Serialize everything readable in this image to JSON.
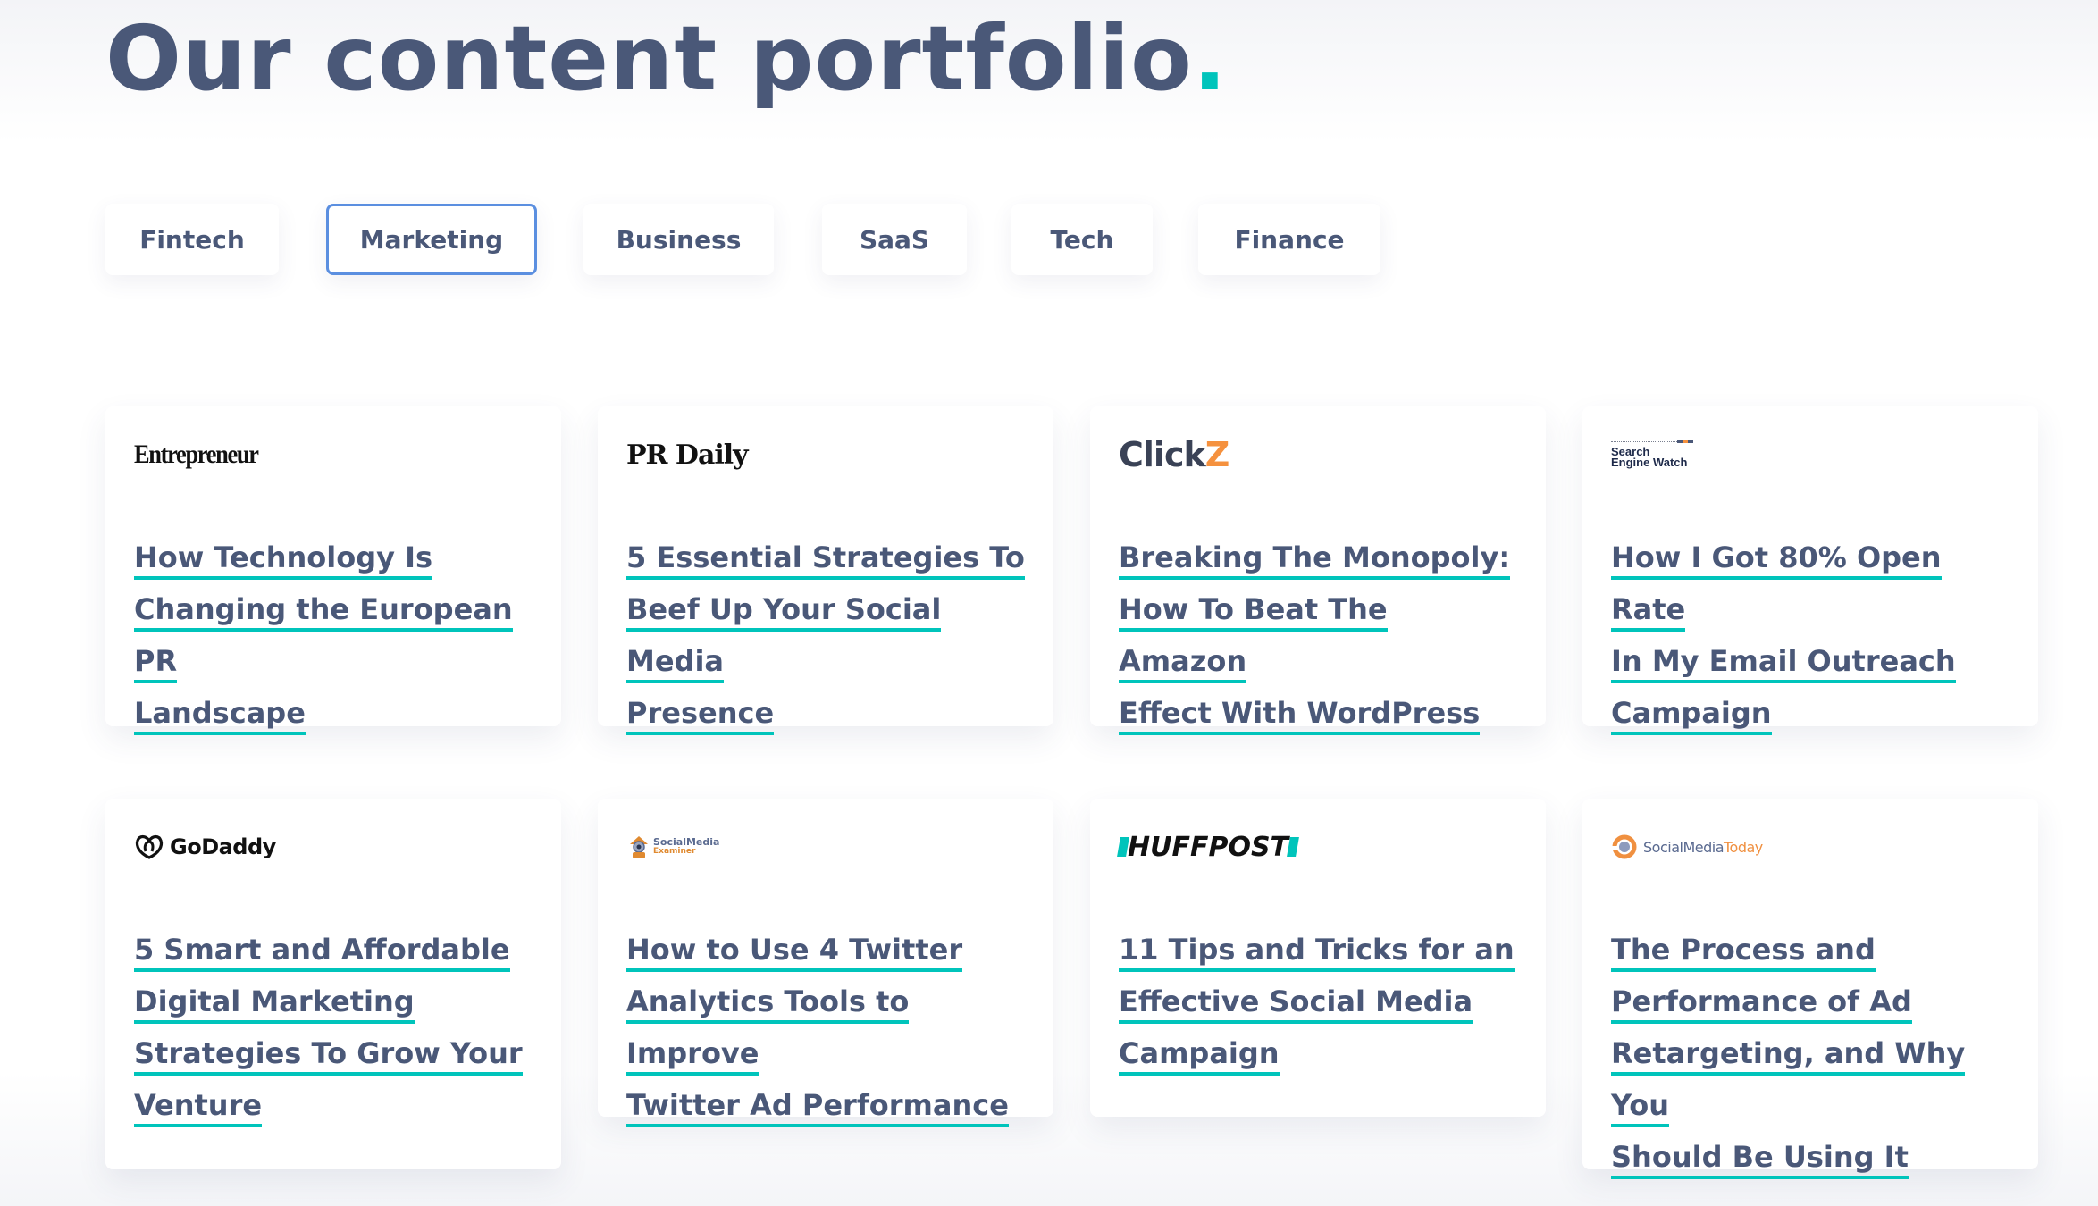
{
  "header": {
    "title": "Our content portfolio",
    "title_dot": "."
  },
  "tabs": [
    {
      "label": "Fintech",
      "active": false
    },
    {
      "label": "Marketing",
      "active": true
    },
    {
      "label": "Business",
      "active": false
    },
    {
      "label": "SaaS",
      "active": false
    },
    {
      "label": "Tech",
      "active": false
    },
    {
      "label": "Finance",
      "active": false
    }
  ],
  "accent_colors": {
    "text": "#4a5878",
    "underline": "#00c4bb",
    "active_tab_border": "#5b8fe0"
  },
  "cards": [
    {
      "publication": "Entrepreneur",
      "logo_icon": "entrepreneur-logo",
      "title_lines": [
        "How Technology Is",
        "Changing the European PR",
        "Landscape"
      ]
    },
    {
      "publication": "PR Daily",
      "logo_icon": "pr-daily-logo",
      "title_lines": [
        "5 Essential Strategies To",
        "Beef Up Your Social Media",
        "Presence"
      ]
    },
    {
      "publication_main": "Click",
      "publication_accent": "Z",
      "logo_icon": "clickz-logo",
      "title_lines": [
        "Breaking The Monopoly:",
        "How To Beat The Amazon",
        "Effect With WordPress"
      ]
    },
    {
      "publication_line1": "Search",
      "publication_line2": "Engine Watch",
      "logo_icon": "search-engine-watch-logo",
      "title_lines": [
        "How I Got 80% Open Rate",
        "In My Email Outreach",
        "Campaign"
      ]
    },
    {
      "publication": "GoDaddy",
      "logo_icon": "godaddy-logo",
      "title_lines": [
        "5 Smart and Affordable",
        "Digital Marketing",
        "Strategies To Grow Your",
        "Venture"
      ]
    },
    {
      "publication_line1": "SocialMedia",
      "publication_line2": "Examiner",
      "logo_icon": "social-media-examiner-logo",
      "title_lines": [
        "How to Use 4 Twitter",
        "Analytics Tools to Improve",
        "Twitter Ad Performance"
      ]
    },
    {
      "publication": "HUFFPOST",
      "logo_icon": "huffpost-logo",
      "title_lines": [
        "11 Tips and Tricks for an",
        "Effective Social Media",
        "Campaign"
      ]
    },
    {
      "publication_main": "SocialMedia",
      "publication_accent": "Today",
      "logo_icon": "social-media-today-logo",
      "title_lines": [
        "The Process and",
        "Performance of Ad",
        "Retargeting, and Why You",
        "Should Be Using It"
      ]
    }
  ]
}
